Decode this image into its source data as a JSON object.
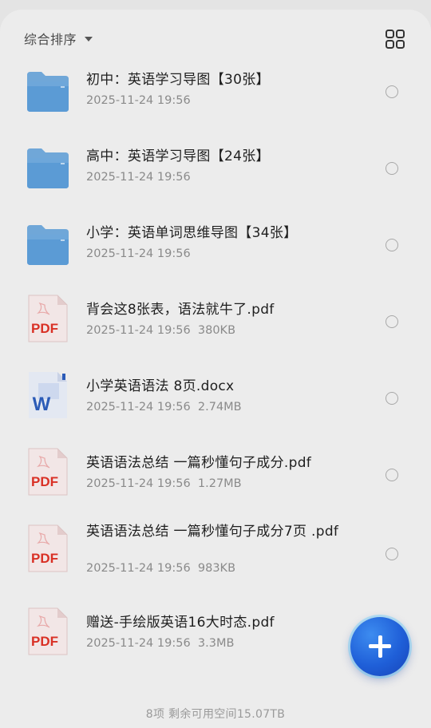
{
  "toolbar": {
    "sort_label": "综合排序",
    "sort_icon": "caret-down-icon",
    "view_icon": "grid-view-icon"
  },
  "files": [
    {
      "type": "folder",
      "name": "初中：英语学习导图【30张】",
      "meta": "2025-11-24 19:56"
    },
    {
      "type": "folder",
      "name": "高中：英语学习导图【24张】",
      "meta": "2025-11-24 19:56"
    },
    {
      "type": "folder",
      "name": "小学：英语单词思维导图【34张】",
      "meta": "2025-11-24 19:56"
    },
    {
      "type": "pdf",
      "name": "背会这8张表，语法就牛了.pdf",
      "meta": "2025-11-24 19:56  380KB"
    },
    {
      "type": "docx",
      "name": "小学英语语法 8页.docx",
      "meta": "2025-11-24 19:56  2.74MB"
    },
    {
      "type": "pdf",
      "name": "英语语法总结 一篇秒懂句子成分.pdf",
      "meta": "2025-11-24 19:56  1.27MB"
    },
    {
      "type": "pdf",
      "name": "英语语法总结 一篇秒懂句子成分7页 .pdf",
      "meta": "2025-11-24 19:56  983KB"
    },
    {
      "type": "pdf",
      "name": "赠送-手绘版英语16大时态.pdf",
      "meta": "2025-11-24 19:56  3.3MB"
    }
  ],
  "icons": {
    "folder": "folder-icon",
    "pdf": "pdf-file-icon",
    "docx": "word-file-icon",
    "pdf_badge": "PDF",
    "docx_badge": "W"
  },
  "fab": {
    "icon": "plus-icon"
  },
  "footer": {
    "summary": "8项 剩余可用空间15.07TB"
  },
  "colors": {
    "folder": "#5b9bd5",
    "pdf": "#d93025",
    "word": "#2b5bb7",
    "fab": "#1f5fd8"
  }
}
